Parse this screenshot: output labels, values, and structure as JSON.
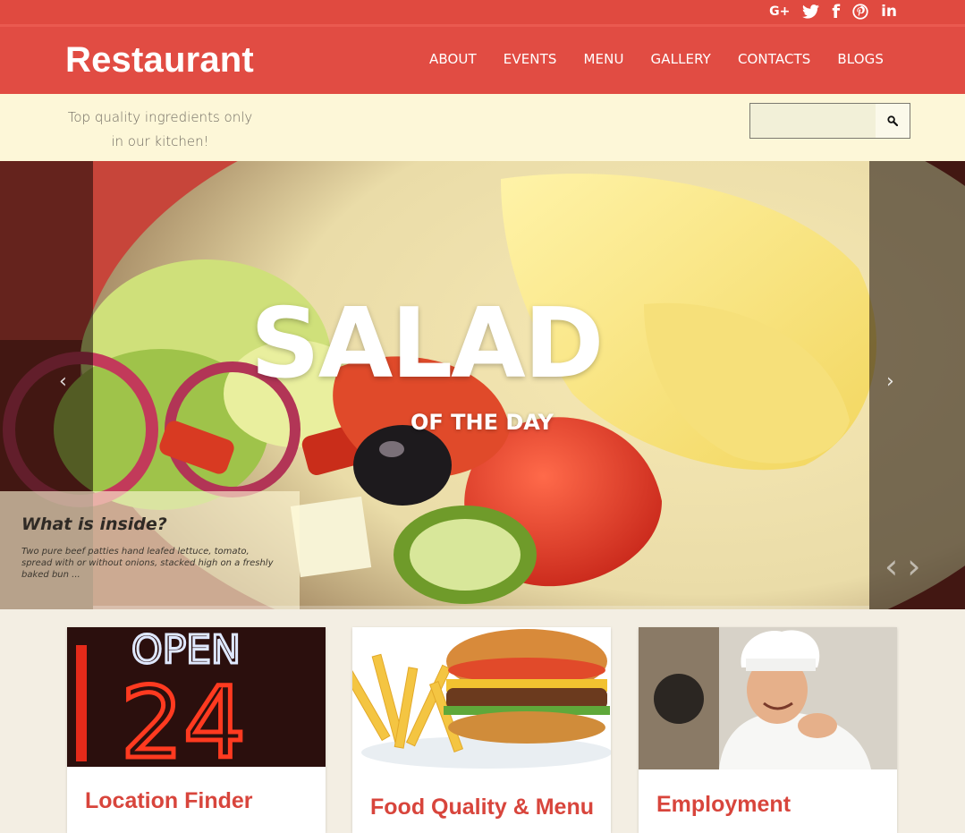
{
  "social": {
    "icons": [
      "google-plus-icon",
      "twitter-icon",
      "facebook-icon",
      "pinterest-icon",
      "linkedin-icon"
    ],
    "google_plus": "G+",
    "facebook": "f",
    "linkedin": "in"
  },
  "header": {
    "logo": "Restaurant",
    "nav": [
      "ABOUT",
      "EVENTS",
      "MENU",
      "GALLERY",
      "CONTACTS",
      "BLOGS"
    ]
  },
  "strip": {
    "tagline_line1": "Top quality ingredients only",
    "tagline_line2": "in our kitchen!",
    "search_placeholder": ""
  },
  "slider": {
    "title": "SALAD",
    "subtitle": "OF THE DAY",
    "caption_title": "What is inside?",
    "caption_text": "Two pure beef patties hand leafed lettuce, tomato, spread with or without onions, stacked high on a freshly baked bun ...",
    "prev_arrow": "‹",
    "next_arrow": "›",
    "thumb_prev": "‹",
    "thumb_next": "›"
  },
  "cards": [
    {
      "title": "Location Finder",
      "image": "neon-open-24-sign"
    },
    {
      "title": "Food Quality & Menu",
      "image": "burger-and-fries"
    },
    {
      "title": "Employment",
      "image": "smiling-chef"
    }
  ],
  "colors": {
    "brand_red": "#e14c43",
    "title_red": "#d8453c",
    "strip_cream": "#fdf7d8"
  }
}
